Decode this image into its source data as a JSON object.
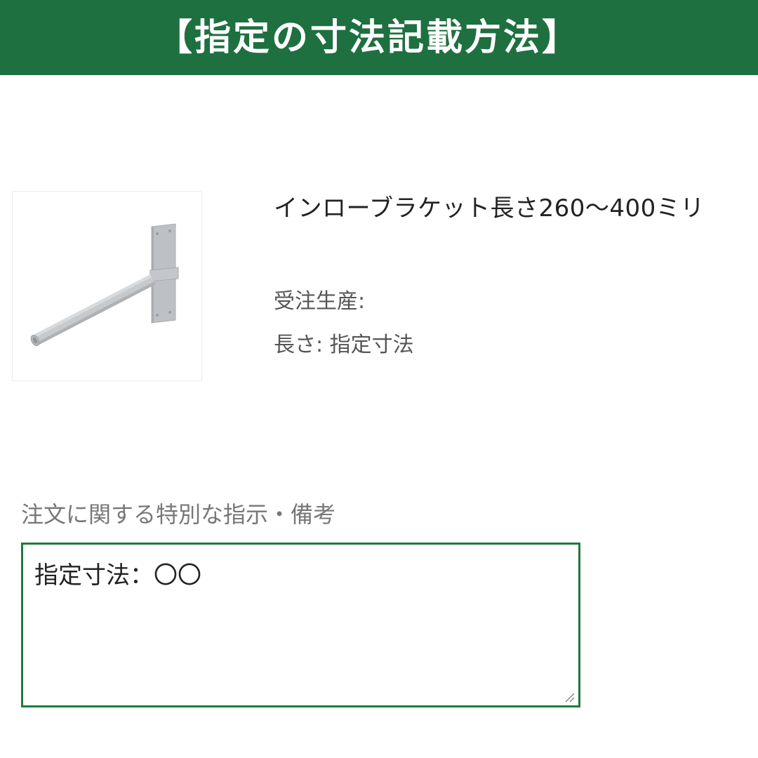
{
  "banner": {
    "title": "【指定の寸法記載方法】",
    "bg_color": "#1e7040",
    "text_color": "#ffffff"
  },
  "product": {
    "image_icon": "bracket-product-image",
    "name": "インローブラケット長さ260〜400ミリ",
    "options": [
      {
        "text": "受注生産:"
      },
      {
        "text": "長さ: 指定寸法"
      }
    ]
  },
  "notes": {
    "label": "注文に関する特別な指示・備考",
    "value": "指定寸法：〇〇",
    "border_color": "#1e7a3c"
  }
}
